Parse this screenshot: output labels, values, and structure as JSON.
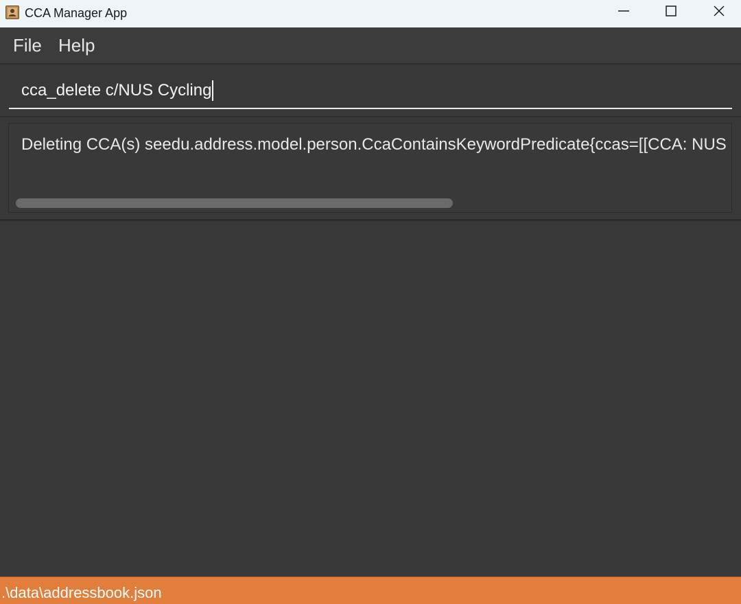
{
  "window": {
    "title": "CCA Manager App",
    "icon": "contact-book-icon",
    "controls": {
      "minimize_icon": "minimize-icon",
      "maximize_icon": "maximize-icon",
      "close_icon": "close-icon"
    }
  },
  "menu": {
    "items": [
      {
        "label": "File"
      },
      {
        "label": "Help"
      }
    ]
  },
  "command_box": {
    "value": "cca_delete c/NUS Cycling"
  },
  "result_display": {
    "text": "Deleting CCA(s) seedu.address.model.person.CcaContainsKeywordPredicate{ccas=[[CCA: NUS C"
  },
  "status_bar": {
    "path": ".\\data\\addressbook.json"
  },
  "colors": {
    "background": "#383838",
    "titlebar": "#eff4f9",
    "status_bar": "#e27e3b",
    "text": "#e6e6e6"
  }
}
